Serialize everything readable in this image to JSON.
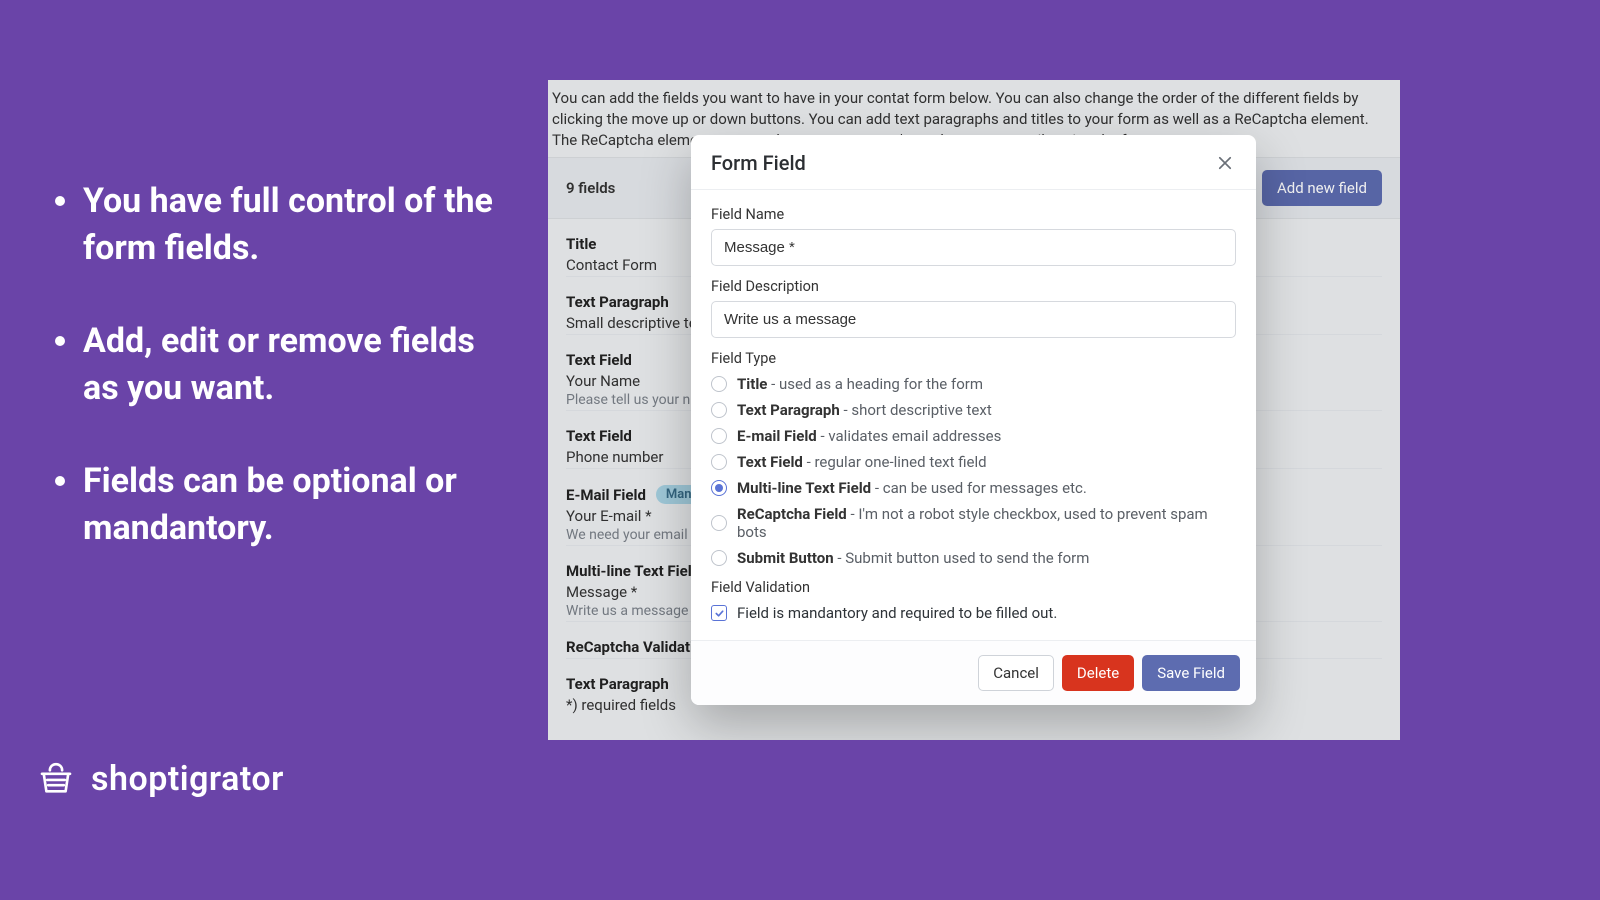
{
  "marketing": {
    "bullets": [
      "You have full control of the form fields.",
      "Add, edit or remove fields as you want.",
      "Fields can be optional or mandantory."
    ]
  },
  "brand": {
    "name": "shoptigrator"
  },
  "app": {
    "intro": "You can add the fields you want to have in your contat form below. You can also change the order of the different fields by clicking the move up or down buttons. You can add text paragraphs and titles to your form as well as a ReCaptcha element. The ReCaptcha element ensures that spammers can't send you spam mails using the form.",
    "toolbar": {
      "count_label": "9 fields",
      "add_button": "Add new field"
    },
    "fields": [
      {
        "kind": "Title",
        "label": "Contact Form",
        "desc": ""
      },
      {
        "kind": "Text Paragraph",
        "label": "Small descriptive text",
        "desc": ""
      },
      {
        "kind": "Text Field",
        "label": "Your Name",
        "desc": "Please tell us your na"
      },
      {
        "kind": "Text Field",
        "label": "Phone number",
        "desc": ""
      },
      {
        "kind": "E-Mail Field",
        "label": "Your E-mail *",
        "desc": "We need your email i",
        "badge": "Manda"
      },
      {
        "kind": "Multi-line Text Field",
        "label": "Message *",
        "desc": "Write us a message"
      },
      {
        "kind": "ReCaptcha Validatio",
        "label": "",
        "desc": ""
      },
      {
        "kind": "Text Paragraph",
        "label": "*) required fields",
        "desc": ""
      }
    ]
  },
  "modal": {
    "title": "Form Field",
    "labels": {
      "field_name": "Field Name",
      "field_description": "Field Description",
      "field_type": "Field Type",
      "field_validation": "Field Validation"
    },
    "field_name_value": "Message *",
    "field_description_value": "Write us a message",
    "types": [
      {
        "name": "Title",
        "suffix": " - used as a heading for the form",
        "selected": false
      },
      {
        "name": "Text Paragraph",
        "suffix": " - short descriptive text",
        "selected": false
      },
      {
        "name": "E-mail Field",
        "suffix": " - validates email addresses",
        "selected": false
      },
      {
        "name": "Text Field",
        "suffix": " - regular one-lined text field",
        "selected": false
      },
      {
        "name": "Multi-line Text Field",
        "suffix": " - can be used for messages etc.",
        "selected": true
      },
      {
        "name": "ReCaptcha Field",
        "suffix": " - I'm not a robot style checkbox, used to prevent spam bots",
        "selected": false
      },
      {
        "name": "Submit Button",
        "suffix": " - Submit button used to send the form",
        "selected": false
      }
    ],
    "validation_checkbox": "Field is mandantory and required to be filled out.",
    "validation_checked": true,
    "buttons": {
      "cancel": "Cancel",
      "delete": "Delete",
      "save": "Save Field"
    }
  }
}
